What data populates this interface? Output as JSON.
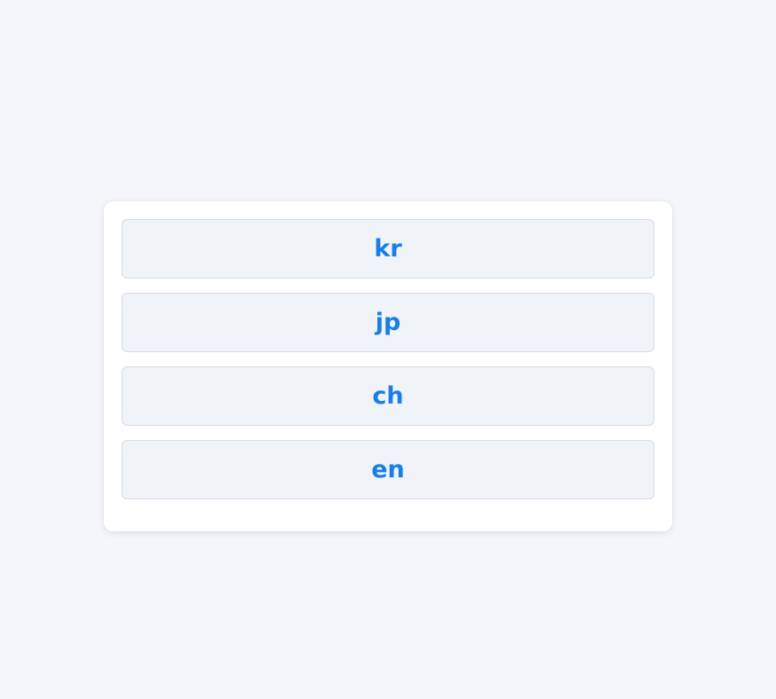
{
  "languages": [
    {
      "label": "kr"
    },
    {
      "label": "jp"
    },
    {
      "label": "ch"
    },
    {
      "label": "en"
    }
  ],
  "colors": {
    "page_background": "#f5f6fa",
    "card_background": "#ffffff",
    "button_background": "#f0f3f8",
    "button_border": "#d6dbe4",
    "accent_text": "#1a7ee8"
  }
}
